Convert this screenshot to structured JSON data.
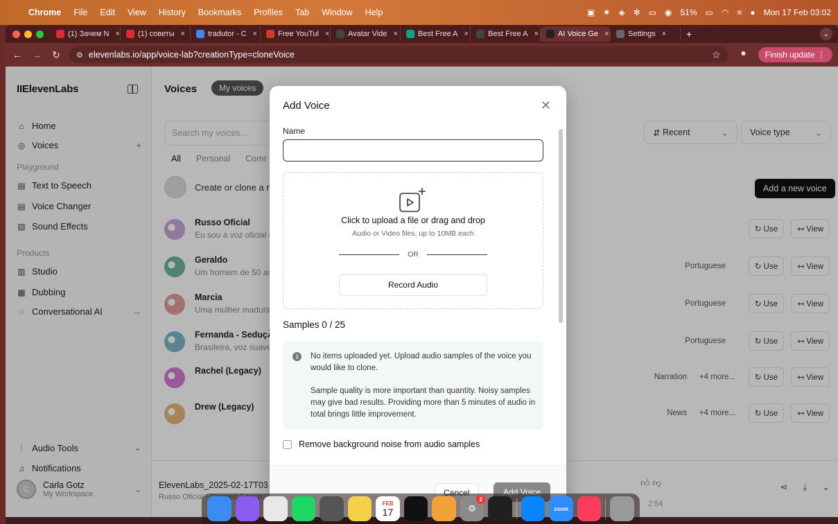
{
  "menubar": {
    "app": "Chrome",
    "items": [
      "File",
      "Edit",
      "View",
      "History",
      "Bookmarks",
      "Profiles",
      "Tab",
      "Window",
      "Help"
    ],
    "battery": "51%",
    "datetime": "Mon 17 Feb 03:02"
  },
  "tabs": [
    {
      "label": "(1) Зачем N",
      "fav_color": "#e02b2b"
    },
    {
      "label": "(1) советы",
      "fav_color": "#e02b2b"
    },
    {
      "label": "tradutor - C",
      "fav_color": "#4285f4"
    },
    {
      "label": "Free YouTul",
      "fav_color": "#d43a2a"
    },
    {
      "label": "Avatar Vide",
      "fav_color": "#444444"
    },
    {
      "label": "Best Free A",
      "fav_color": "#10a37f"
    },
    {
      "label": "Best Free A",
      "fav_color": "#444444"
    },
    {
      "label": "AI Voice Ge",
      "fav_color": "#222222",
      "active": true
    },
    {
      "label": "Settings",
      "fav_color": "#666666"
    }
  ],
  "toolbar": {
    "url": "elevenlabs.io/app/voice-lab?creationType=cloneVoice",
    "finish_update": "Finish update"
  },
  "sidebar": {
    "logo": "IIElevenLabs",
    "home": "Home",
    "voices": "Voices",
    "playground_label": "Playground",
    "text_to_speech": "Text to Speech",
    "voice_changer": "Voice Changer",
    "sound_effects": "Sound Effects",
    "products_label": "Products",
    "studio": "Studio",
    "dubbing": "Dubbing",
    "conversational_ai": "Conversational AI",
    "audio_tools": "Audio Tools",
    "notifications": "Notifications",
    "account_name": "Carla Gotz",
    "workspace": "My Workspace"
  },
  "main": {
    "title": "Voices",
    "pill": "My voices",
    "search_placeholder": "Search my voices...",
    "filters": [
      "All",
      "Personal",
      "Comr"
    ],
    "create": "Create or clone a n",
    "sort": "Recent",
    "voice_type": "Voice type",
    "add_new": "Add a new voice",
    "use": "Use",
    "view": "View",
    "voices": [
      {
        "name": "Russo Oficial",
        "desc": "Eu sou a voz oficial c",
        "lang": "",
        "more": "",
        "color": "#c9a6d8"
      },
      {
        "name": "Geraldo",
        "desc": "Um homem de 50 an",
        "lang": "Portuguese",
        "more": "",
        "color": "#6fb3a2"
      },
      {
        "name": "Marcia",
        "desc": "Uma mulher madura,",
        "lang": "Portuguese",
        "more": "",
        "color": "#e39a9a"
      },
      {
        "name": "Fernanda - SeduçÃo",
        "desc": "Brasileira, voz suave",
        "lang": "Portuguese",
        "more": "",
        "color": "#7ab6c9"
      },
      {
        "name": "Rachel (Legacy)",
        "desc": "",
        "lang": "Narration",
        "more": "+4 more...",
        "color": "#d67bd0"
      },
      {
        "name": "Drew (Legacy)",
        "desc": "",
        "lang": "News",
        "more": "+4 more...",
        "color": "#e6b77a"
      }
    ],
    "player_file": "ElevenLabs_2025-02-17T03",
    "player_sub": "Russo Oficial · Created 1 seco",
    "player_dur": "2:54"
  },
  "modal": {
    "title": "Add Voice",
    "name_label": "Name",
    "name_value": "",
    "upload_title": "Click to upload a file or drag and drop",
    "upload_sub": "Audio or Video files, up to 10MB each",
    "or": "OR",
    "record": "Record Audio",
    "samples": "Samples  0 / 25",
    "info_1": "No items uploaded yet. Upload audio samples of the voice you would like to clone.",
    "info_2": "Sample quality is more important than quantity. Noisy samples may give bad results. Providing more than 5 minutes of audio in total brings little improvement.",
    "noise_label": "Remove background noise from audio samples",
    "cancel": "Cancel",
    "add": "Add Voice"
  },
  "dock": [
    {
      "name": "finder",
      "color": "#3b8cf0"
    },
    {
      "name": "launchpad",
      "color": "#8a5cf0"
    },
    {
      "name": "chrome",
      "color": "#e8e8e8"
    },
    {
      "name": "spotify",
      "color": "#1ed760"
    },
    {
      "name": "calculator",
      "color": "#555555"
    },
    {
      "name": "notes",
      "color": "#f5d04a"
    },
    {
      "name": "calendar",
      "color": "#ffffff"
    },
    {
      "name": "capcut",
      "color": "#111111"
    },
    {
      "name": "photos",
      "color": "#f2a23a"
    },
    {
      "name": "settings",
      "color": "#8a8a8a"
    },
    {
      "name": "chatgpt",
      "color": "#202020"
    },
    {
      "name": "skype",
      "color": "#0a84ff"
    },
    {
      "name": "zoom",
      "color": "#2d8cff"
    },
    {
      "name": "music",
      "color": "#fa3d5a"
    },
    {
      "name": "trash",
      "color": "#9a9a9a"
    }
  ],
  "dock_labels": {
    "calendar_month": "FEB",
    "calendar_day": "17",
    "zoom": "zoom",
    "settings_badge": "2"
  }
}
